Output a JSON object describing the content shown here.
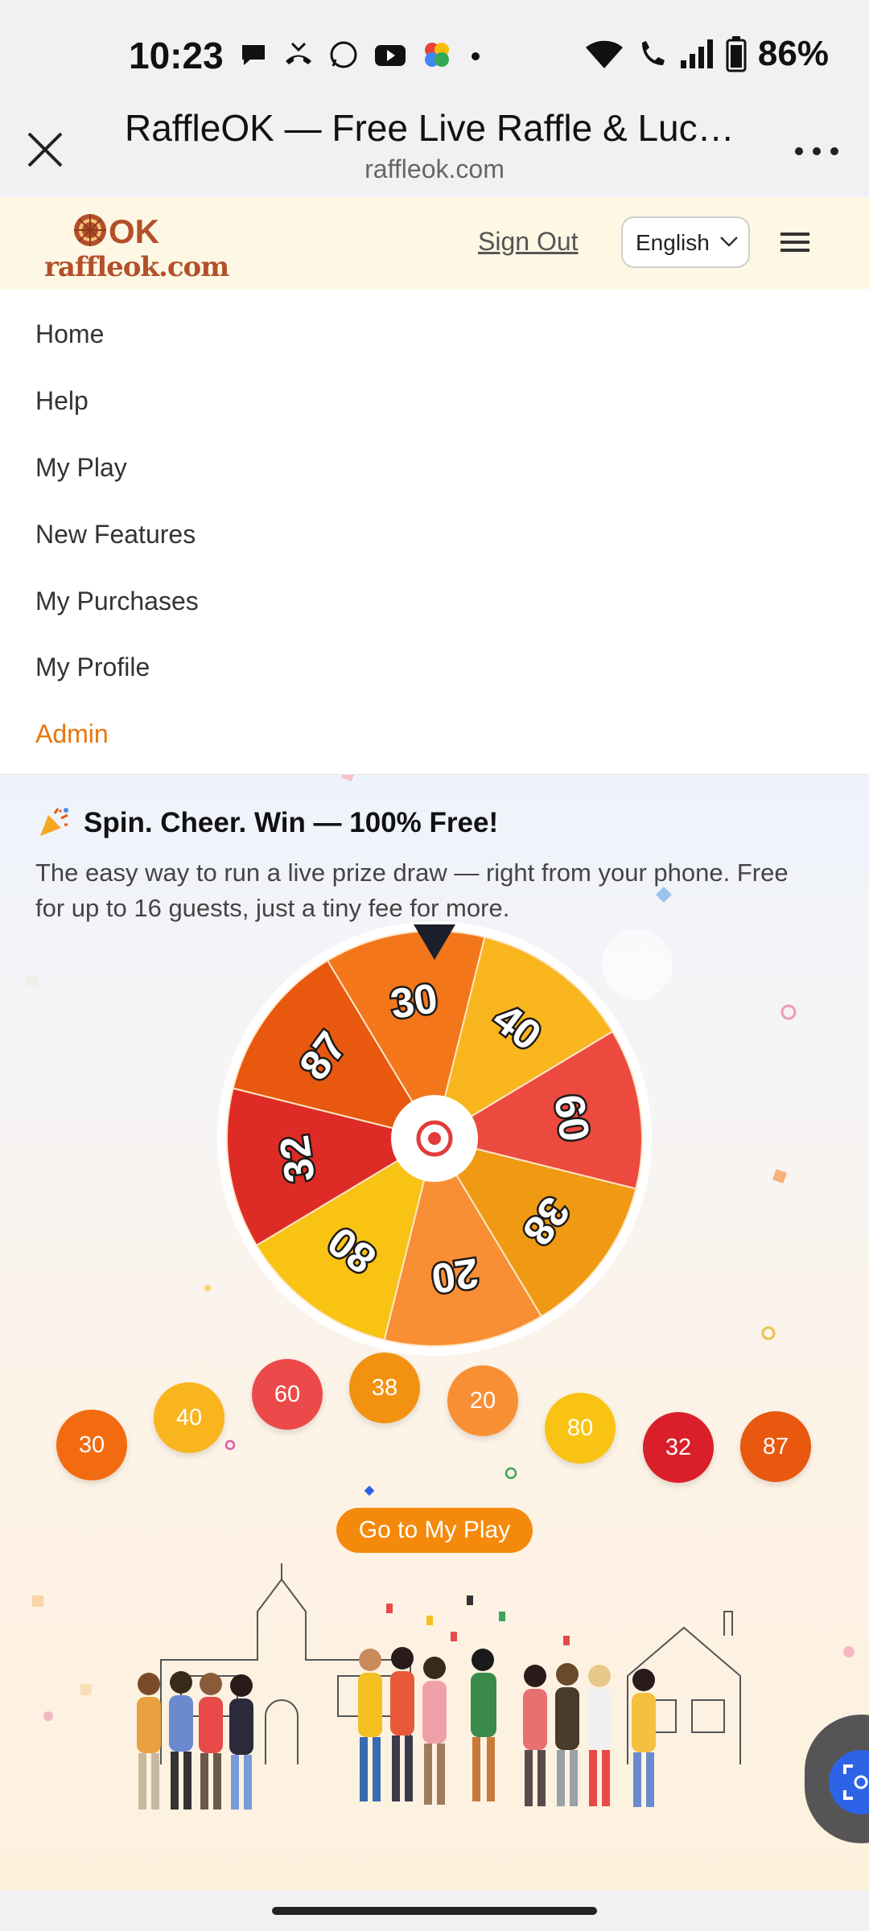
{
  "status_bar": {
    "time": "10:23",
    "battery": "86%"
  },
  "browser": {
    "title": "RaffleOK — Free Live Raffle & Lucky…",
    "url": "raffleok.com"
  },
  "site_header": {
    "logo_text": "raffleok.com",
    "logo_mark": "OK",
    "sign_out": "Sign Out",
    "language": "English"
  },
  "menu": {
    "items": [
      "Home",
      "Help",
      "My Play",
      "New Features",
      "My Purchases",
      "My Profile",
      "Admin"
    ],
    "admin_color": "#e8760a"
  },
  "hero": {
    "headline": "Spin. Cheer. Win — 100% Free!",
    "subtext": "The easy way to run a live prize draw — right from your phone. Free for up to 16 guests, just a tiny fee for more.",
    "wheel_segments": [
      "40",
      "60",
      "38",
      "20",
      "80",
      "32",
      "87",
      "30"
    ],
    "wheel_colors": [
      "#f9b51e",
      "#ec4a3f",
      "#ef9a12",
      "#f98f35",
      "#f8c313",
      "#de2b26",
      "#e8580e",
      "#f3761a"
    ],
    "chips": [
      "30",
      "40",
      "60",
      "38",
      "20",
      "80",
      "32",
      "87"
    ],
    "chip_colors": [
      "#f36b10",
      "#f9b51e",
      "#ec4a4a",
      "#f29210",
      "#f98f35",
      "#f8c313",
      "#da1f2a",
      "#e8580e"
    ],
    "cta": "Go to My Play"
  }
}
